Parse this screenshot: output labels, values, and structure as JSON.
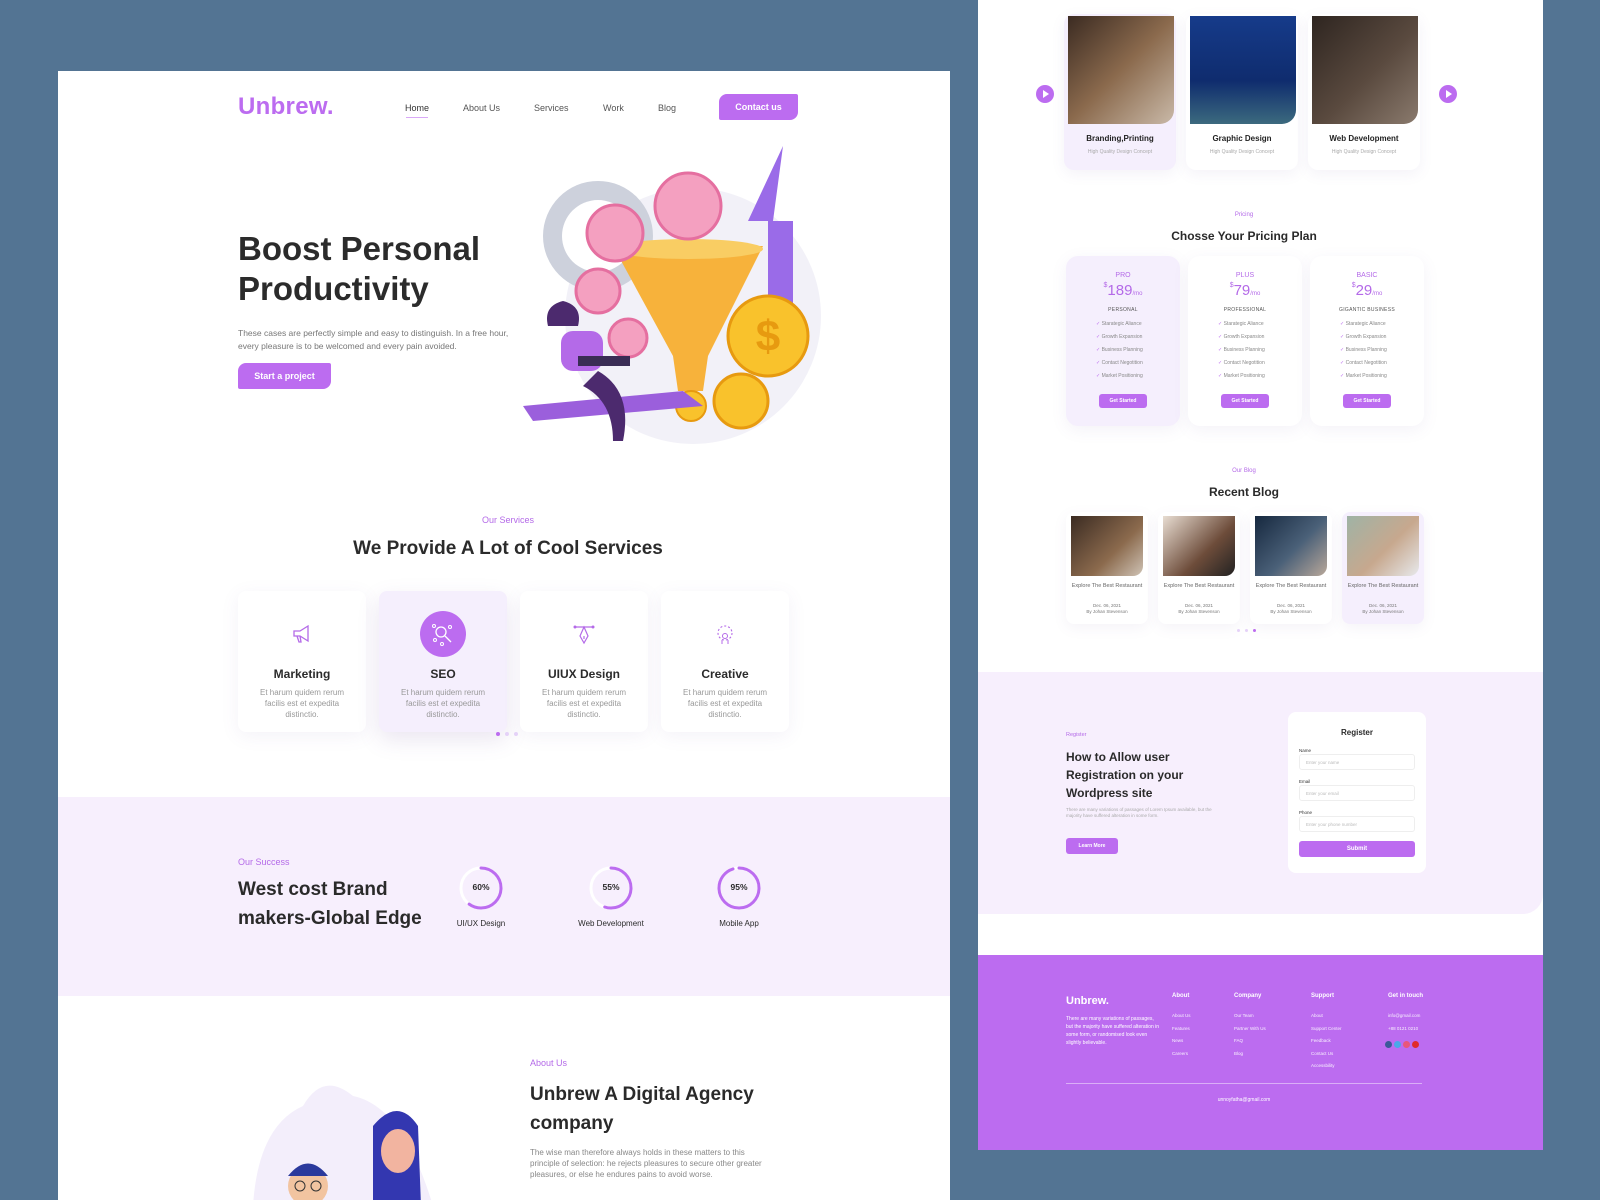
{
  "left_page": {
    "logo": "Unbrew.",
    "nav": [
      {
        "label": "Home",
        "active": true
      },
      {
        "label": "About Us",
        "active": false
      },
      {
        "label": "Services",
        "active": false
      },
      {
        "label": "Work",
        "active": false
      },
      {
        "label": "Blog",
        "active": false
      }
    ],
    "contact_button": "Contact us",
    "hero": {
      "title": "Boost Personal Productivity",
      "text": "These cases are perfectly simple and easy to distinguish. In a free hour, every pleasure is to be welcomed and every pain avoided.",
      "button": "Start a project",
      "illustration": "productivity-funnel-illustration"
    },
    "services": {
      "kicker": "Our Services",
      "title": "We Provide A Lot of Cool Services",
      "items": [
        {
          "title": "Marketing",
          "icon": "megaphone-icon",
          "desc": "Et harum quidem rerum facilis est et expedita distinctio.",
          "active": false
        },
        {
          "title": "SEO",
          "icon": "seo-search-icon",
          "desc": "Et harum quidem rerum facilis est et expedita distinctio.",
          "active": true
        },
        {
          "title": "UIUX Design",
          "icon": "pen-tool-icon",
          "desc": "Et harum quidem rerum facilis est et expedita distinctio.",
          "active": false
        },
        {
          "title": "Creative",
          "icon": "lightbulb-head-icon",
          "desc": "Et harum quidem rerum facilis est et expedita distinctio.",
          "active": false
        }
      ],
      "pager": {
        "count": 3,
        "active": 0
      }
    },
    "success": {
      "kicker": "Our Success",
      "title": "West cost Brand makers-Global Edge",
      "stats": [
        {
          "label": "UI/UX Design",
          "value": "60%",
          "percent": 60
        },
        {
          "label": "Web Development",
          "value": "55%",
          "percent": 55
        },
        {
          "label": "Mobile App",
          "value": "95%",
          "percent": 95
        }
      ]
    },
    "about": {
      "kicker": "About Us",
      "title": "Unbrew A Digital Agency company",
      "text": "The wise man therefore always holds in these matters to this principle of selection: he rejects pleasures to secure other greater pleasures, or else he endures pains to avoid worse."
    }
  },
  "right_page": {
    "portfolio": [
      {
        "title": "Branding,Printing",
        "subtitle": "High Quality Design Concept",
        "active": true
      },
      {
        "title": "Graphic Design",
        "subtitle": "High Quality Design Concept",
        "active": false
      },
      {
        "title": "Web Development",
        "subtitle": "High Quality Design Concept",
        "active": false
      }
    ],
    "pricing": {
      "kicker": "Pricing",
      "title": "Chosse Your Pricing Plan",
      "plans": [
        {
          "name": "PRO",
          "currency": "$",
          "price": "189",
          "period": "/mo",
          "tier": "PERSONAL",
          "active": true,
          "features": [
            "Starategic Aliance",
            "Growth Expansion",
            "Business Planning",
            "Contact Negotition",
            "Market Positioning"
          ],
          "button": "Get Started"
        },
        {
          "name": "PLUS",
          "currency": "$",
          "price": "79",
          "period": "/mo",
          "tier": "PROFESSIONAL",
          "active": false,
          "features": [
            "Starategic Aliance",
            "Growth Expansion",
            "Business Planning",
            "Contact Negotition",
            "Market Positioning"
          ],
          "button": "Get Started"
        },
        {
          "name": "BASIC",
          "currency": "$",
          "price": "29",
          "period": "/mo",
          "tier": "GIGANTIC BUSINESS",
          "active": false,
          "features": [
            "Starategic Aliance",
            "Growth Expansion",
            "Business Planning",
            "Contact Negotition",
            "Market Positioning"
          ],
          "button": "Get Started"
        }
      ]
    },
    "blog": {
      "kicker": "Our Blog",
      "title": "Recent Blog",
      "posts": [
        {
          "title": "Explore The Best Restaurant",
          "date": "Dec. 06, 2021",
          "author": "By Johan Stevenson",
          "active": false
        },
        {
          "title": "Explore The Best Restaurant",
          "date": "Dec. 06, 2021",
          "author": "By Johan Stevenson",
          "active": false
        },
        {
          "title": "Explore The Best Restaurant",
          "date": "Dec. 06, 2021",
          "author": "By Johan Stevenson",
          "active": false
        },
        {
          "title": "Explore The Best Restaurant",
          "date": "Dec. 06, 2021",
          "author": "By Johan Stevenson",
          "active": true
        }
      ],
      "pager": {
        "count": 3,
        "active": 2
      }
    },
    "register": {
      "kicker": "Register",
      "title": "How to Allow user Registration on your Wordpress site",
      "text": "There are many variations of passages of Lorem Ipsum available, but the majority have suffered alteration in some form.",
      "button": "Learn More",
      "form": {
        "title": "Register",
        "fields": [
          {
            "label": "Name",
            "placeholder": "Enter your name"
          },
          {
            "label": "Email",
            "placeholder": "Enter your email"
          },
          {
            "label": "Phone",
            "placeholder": "Enter your phone number"
          }
        ],
        "submit": "Submit"
      }
    },
    "footer": {
      "logo": "Unbrew.",
      "text": "There are many variations of passages, but the majority have suffered alteration in some form, or randomised look even slightly believable.",
      "columns": [
        {
          "heading": "About",
          "items": [
            "About Us",
            "Features",
            "News",
            "Careers"
          ]
        },
        {
          "heading": "Company",
          "items": [
            "Our Team",
            "Partner With Us",
            "FAQ",
            "Blog"
          ]
        },
        {
          "heading": "Support",
          "items": [
            "About",
            "Support Center",
            "Feedback",
            "Contact Us",
            "Accessbility"
          ]
        },
        {
          "heading": "Get in touch",
          "items": [
            "info@gmail.com",
            "+88 0121 0210"
          ]
        }
      ],
      "social": [
        "facebook-icon",
        "twitter-icon",
        "instagram-icon",
        "youtube-icon"
      ],
      "copyright_email": "unnoyfatha@gmail.com"
    }
  },
  "colors": {
    "accent": "#bc6cf0",
    "accent_light": "#f7effd",
    "background": "#537493",
    "text_dark": "#2b2b2b"
  }
}
